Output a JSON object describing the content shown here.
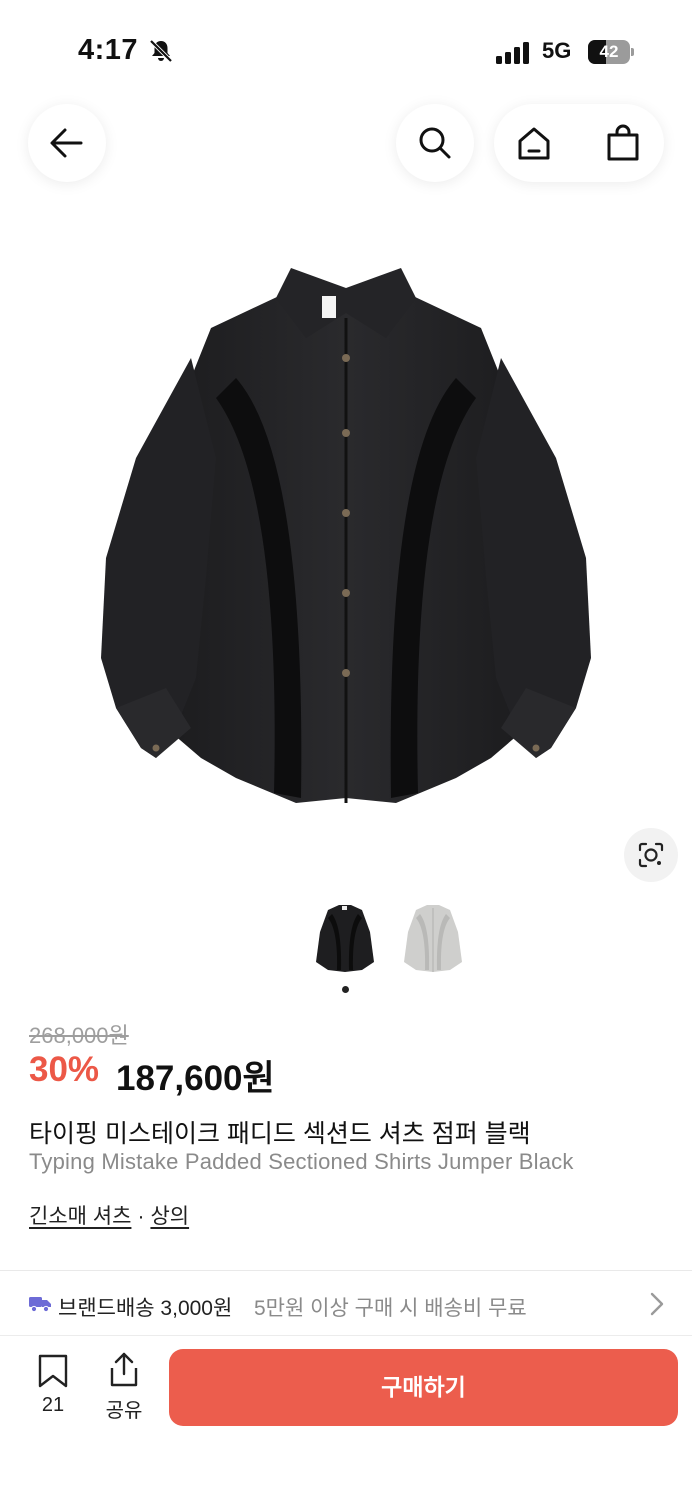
{
  "status_bar": {
    "time": "4:17",
    "network": "5G",
    "battery_level": "42",
    "icons": [
      "bell-slash-icon",
      "signal-bars-icon",
      "battery-icon"
    ]
  },
  "nav": {
    "icons": [
      "arrow-left-icon",
      "search-icon",
      "home-icon",
      "shopping-bag-icon"
    ]
  },
  "product": {
    "original_price": "268,000원",
    "discount": "30%",
    "sale_price": "187,600원",
    "title_ko": "타이핑 미스테이크 패디드 섹션드 셔츠 점퍼 블랙",
    "title_en": "Typing Mistake Padded Sectioned Shirts Jumper Black",
    "category": "긴소매 셔츠",
    "category_separator": "·",
    "parent_category": "상의",
    "thumbnail_colors": [
      "#1e1e20",
      "#cfcfcd"
    ],
    "selected_thumbnail": 1
  },
  "shipping": {
    "label": "브랜드배송 3,000원",
    "note": "5만원 이상 구매 시 배송비 무료",
    "accent": "#6d6bd6"
  },
  "bottom_bar": {
    "bookmark_count": "21",
    "share_label": "공유",
    "buy_label": "구매하기",
    "buy_color": "#ec5d4d"
  },
  "colors": {
    "discount": "#ec5847",
    "muted_text": "#8a8a8a"
  }
}
